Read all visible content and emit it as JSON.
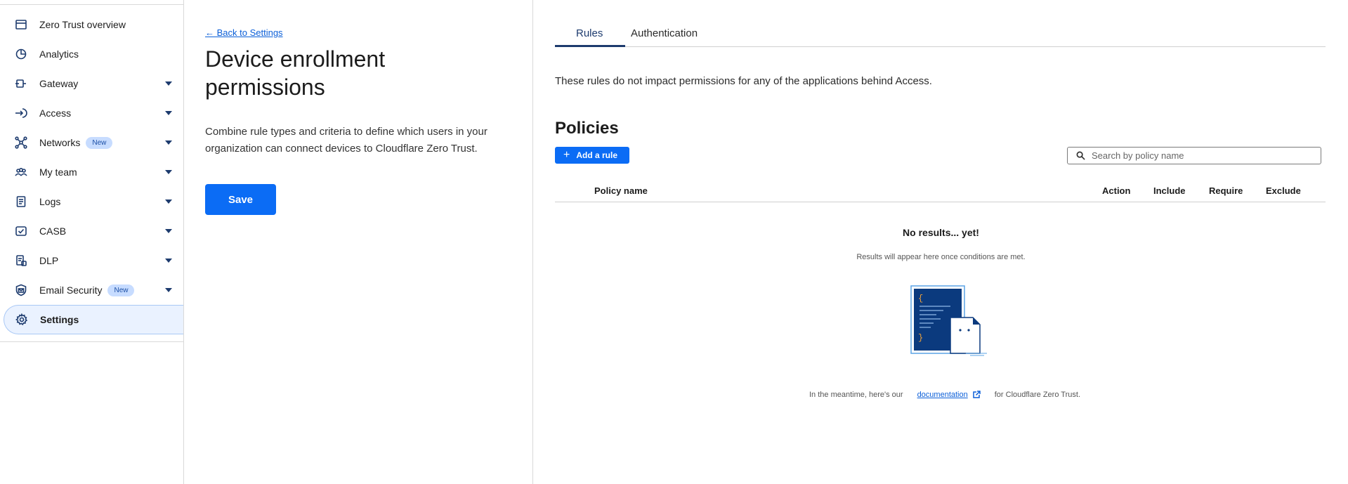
{
  "sidebar": {
    "items": [
      {
        "label": "Zero Trust overview",
        "icon": "window-icon",
        "badge": "",
        "has_caret": false,
        "active": false
      },
      {
        "label": "Analytics",
        "icon": "pie-chart-icon",
        "badge": "",
        "has_caret": false,
        "active": false
      },
      {
        "label": "Gateway",
        "icon": "gateway-icon",
        "badge": "",
        "has_caret": true,
        "active": false
      },
      {
        "label": "Access",
        "icon": "access-icon",
        "badge": "",
        "has_caret": true,
        "active": false
      },
      {
        "label": "Networks",
        "icon": "network-icon",
        "badge": "New",
        "has_caret": true,
        "active": false
      },
      {
        "label": "My team",
        "icon": "team-icon",
        "badge": "",
        "has_caret": true,
        "active": false
      },
      {
        "label": "Logs",
        "icon": "logs-icon",
        "badge": "",
        "has_caret": true,
        "active": false
      },
      {
        "label": "CASB",
        "icon": "casb-icon",
        "badge": "",
        "has_caret": true,
        "active": false
      },
      {
        "label": "DLP",
        "icon": "dlp-icon",
        "badge": "",
        "has_caret": true,
        "active": false
      },
      {
        "label": "Email Security",
        "icon": "email-security-icon",
        "badge": "New",
        "has_caret": true,
        "active": false
      },
      {
        "label": "Settings",
        "icon": "gear-icon",
        "badge": "",
        "has_caret": false,
        "active": true
      }
    ]
  },
  "middle": {
    "back_link": "← Back to Settings",
    "title": "Device enrollment permissions",
    "description": "Combine rule types and criteria to define which users in your organization can connect devices to Cloudflare Zero Trust.",
    "save_label": "Save"
  },
  "right": {
    "tabs": [
      {
        "label": "Rules",
        "active": true
      },
      {
        "label": "Authentication",
        "active": false
      }
    ],
    "info_text": "These rules do not impact permissions for any of the applications behind Access.",
    "policies_title": "Policies",
    "add_rule_label": "Add a rule",
    "search_placeholder": "Search by policy name",
    "table_headers": {
      "name": "Policy name",
      "action": "Action",
      "include": "Include",
      "require": "Require",
      "exclude": "Exclude"
    },
    "empty_title": "No results... yet!",
    "empty_subtitle": "Results will appear here once conditions are met.",
    "footer_before": "In the meantime, here's our",
    "footer_link": "documentation",
    "footer_after": "for Cloudflare Zero Trust."
  },
  "colors": {
    "accent": "#0b6cf5",
    "nav_icon": "#1d3b6e",
    "link": "#0b5fd8",
    "badge_bg": "#c7dcff"
  }
}
